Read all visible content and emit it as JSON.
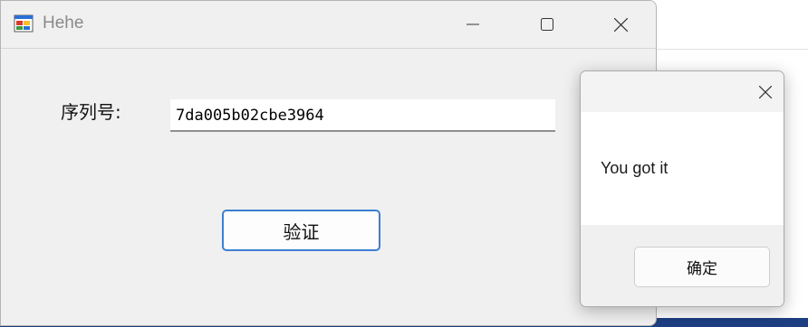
{
  "main_window": {
    "title": "Hehe",
    "icons": {
      "app": "app-window-icon",
      "minimize": "minimize-icon",
      "maximize": "maximize-icon",
      "close": "close-icon"
    },
    "form": {
      "serial_label": "序列号:",
      "serial_value": "7da005b02cbe3964",
      "verify_label": "验证"
    }
  },
  "message_box": {
    "message": "You got it",
    "ok_label": "确定",
    "icons": {
      "close": "close-icon"
    }
  },
  "colors": {
    "window_bg": "#f0f0f0",
    "accent_border": "#3d7fd0",
    "taskbar": "#1d3f82"
  }
}
